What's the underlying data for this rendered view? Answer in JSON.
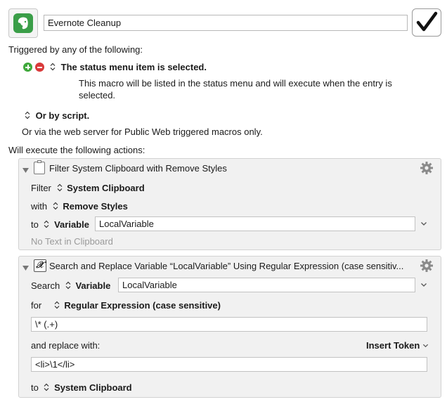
{
  "header": {
    "macro_name": "Evernote Cleanup"
  },
  "triggers": {
    "heading": "Triggered by any of the following:",
    "status_menu_label": "The status menu item is selected.",
    "status_menu_desc_line1": "This macro will be listed in the status menu and will execute when the entry is",
    "status_menu_desc_line2": "selected.",
    "script_label": "Or by script.",
    "web_server_text": "Or via the web server for Public Web triggered macros only."
  },
  "actions_heading": "Will execute the following actions:",
  "action1": {
    "title": "Filter System Clipboard with Remove Styles",
    "filter_label": "Filter",
    "filter_value": "System Clipboard",
    "with_label": "with",
    "with_value": "Remove Styles",
    "to_label": "to",
    "to_value": "Variable",
    "variable_name": "LocalVariable",
    "status_text": "No Text in Clipboard"
  },
  "action2": {
    "title": "Search and Replace Variable “LocalVariable” Using Regular Expression (case sensitiv...",
    "search_label": "Search",
    "search_value": "Variable",
    "variable_name": "LocalVariable",
    "for_label": "for",
    "for_value": "Regular Expression (case sensitive)",
    "pattern": "\\* (.+)",
    "replace_label": "and replace with:",
    "insert_token_label": "Insert Token",
    "replacement": "<li>\\1</li>",
    "to_label": "to",
    "to_value": "System Clipboard"
  },
  "colors": {
    "accent_green": "#3fa83b",
    "remove_red": "#d93a3a",
    "action_bg": "#f1f1f1"
  }
}
